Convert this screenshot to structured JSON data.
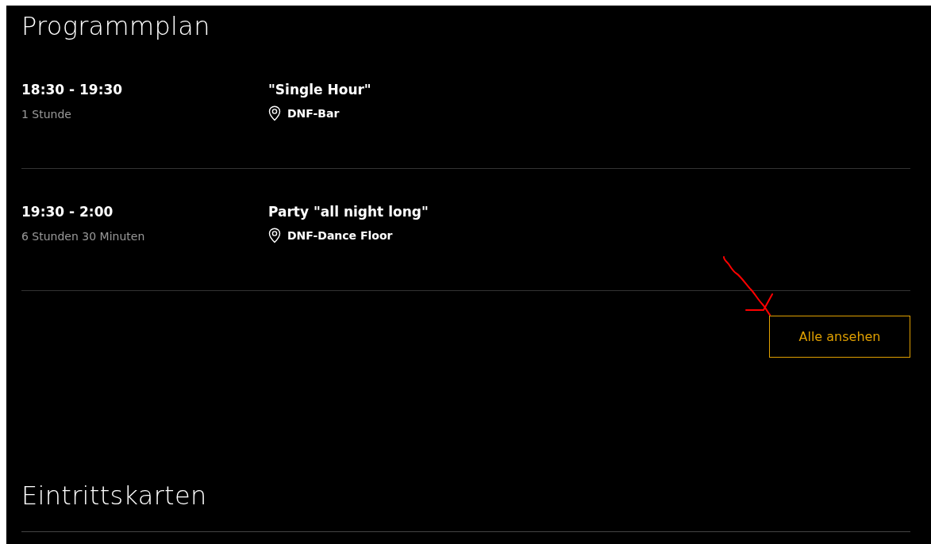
{
  "sections": [
    {
      "title": "Programmplan",
      "events": [
        {
          "time": "18:30 - 19:30",
          "duration": "1 Stunde",
          "name": "\"Single Hour\"",
          "location": "DNF-Bar"
        },
        {
          "time": "19:30 - 2:00",
          "duration": "6 Stunden 30 Minuten",
          "name": "Party \"all night long\"",
          "location": "DNF-Dance Floor"
        }
      ],
      "button": "Alle ansehen"
    },
    {
      "title": "Eintrittskarten"
    }
  ]
}
